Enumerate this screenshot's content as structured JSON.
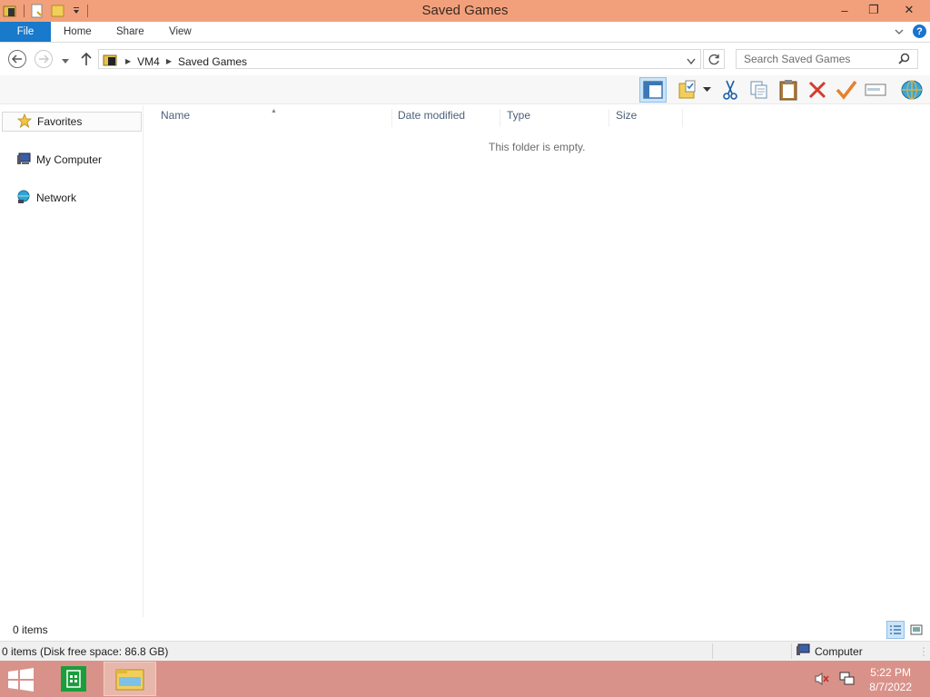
{
  "window": {
    "title": "Saved Games",
    "controls": {
      "minimize": "–",
      "restore": "❐",
      "close": "✕"
    }
  },
  "ribbon": {
    "tabs": [
      "File",
      "Home",
      "Share",
      "View"
    ]
  },
  "address": {
    "crumbs": [
      "VM4",
      "Saved Games"
    ],
    "search_placeholder": "Search Saved Games"
  },
  "nav": {
    "items": [
      "Favorites",
      "My Computer",
      "Network"
    ]
  },
  "filelist": {
    "columns": [
      "Name",
      "Date modified",
      "Type",
      "Size"
    ],
    "empty_text": "This folder is empty."
  },
  "status": {
    "items_text": "0 items",
    "detail_text": "0 items (Disk free space: 86.8 GB)",
    "zone_text": "Computer"
  },
  "taskbar": {
    "time": "5:22 PM",
    "date": "8/7/2022"
  },
  "colors": {
    "titlebar": "#f2a07b",
    "file_tab": "#1979ca",
    "taskbar": "#d9928a"
  }
}
